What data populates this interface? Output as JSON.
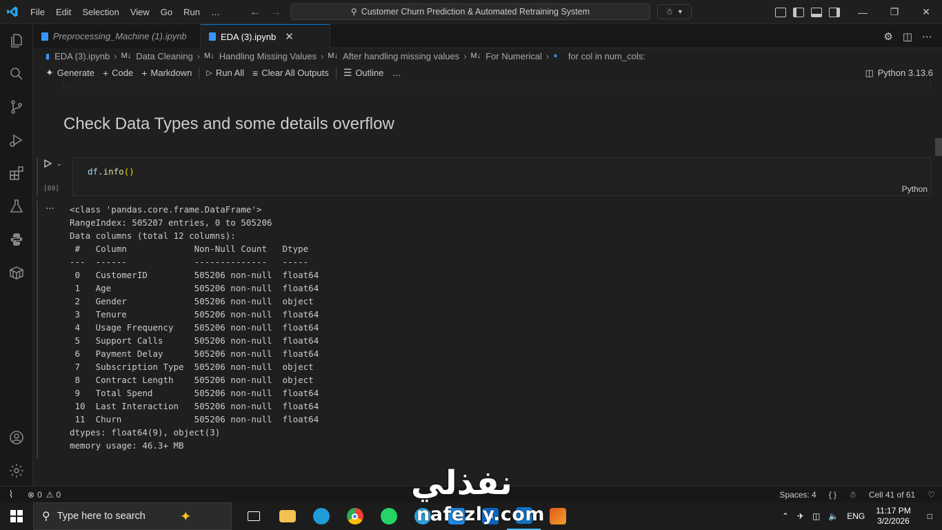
{
  "window": {
    "command_center_text": "Customer Churn Prediction & Automated Retraining System",
    "menu": [
      "File",
      "Edit",
      "Selection",
      "View",
      "Go",
      "Run",
      "…"
    ]
  },
  "tabs": [
    {
      "label": "Preprocessing_Machine (1).ipynb",
      "active": false
    },
    {
      "label": "EDA (3).ipynb",
      "active": true
    }
  ],
  "breadcrumbs": [
    {
      "icon": "notebook-icon",
      "label": "EDA (3).ipynb"
    },
    {
      "icon": "markdown-icon",
      "label": "Data Cleaning"
    },
    {
      "icon": "markdown-icon",
      "label": "Handling Missing Values"
    },
    {
      "icon": "markdown-icon",
      "label": "After handling missing values"
    },
    {
      "icon": "markdown-icon",
      "label": "For Numerical"
    },
    {
      "icon": "python-icon",
      "label": "for col in num_cols:"
    }
  ],
  "toolbar": {
    "generate": "Generate",
    "code": "Code",
    "markdown": "Markdown",
    "run_all": "Run All",
    "clear_outputs": "Clear All Outputs",
    "outline": "Outline",
    "more": "…",
    "kernel": "Python 3.13.6"
  },
  "notebook": {
    "heading": "Check Data Types and some details overflow",
    "cell": {
      "code_obj": "df",
      "code_dot": ".",
      "code_fn": "info",
      "code_paren": "()",
      "execution_count": "[69]",
      "language": "Python"
    },
    "output_lines": [
      "<class 'pandas.core.frame.DataFrame'>",
      "RangeIndex: 505207 entries, 0 to 505206",
      "Data columns (total 12 columns):",
      " #   Column             Non-Null Count   Dtype  ",
      "---  ------             --------------   -----  ",
      " 0   CustomerID         505206 non-null  float64",
      " 1   Age                505206 non-null  float64",
      " 2   Gender             505206 non-null  object ",
      " 3   Tenure             505206 non-null  float64",
      " 4   Usage Frequency    505206 non-null  float64",
      " 5   Support Calls      505206 non-null  float64",
      " 6   Payment Delay      505206 non-null  float64",
      " 7   Subscription Type  505206 non-null  object ",
      " 8   Contract Length    505206 non-null  object ",
      " 9   Total Spend        505206 non-null  float64",
      " 10  Last Interaction   505206 non-null  float64",
      " 11  Churn              505206 non-null  float64",
      "dtypes: float64(9), object(3)",
      "memory usage: 46.3+ MB"
    ]
  },
  "statusbar": {
    "errors": "0",
    "warnings": "0",
    "spaces": "Spaces: 4",
    "braces": "{ }",
    "cell_position": "Cell 41 of 61"
  },
  "taskbar": {
    "search_placeholder": "Type here to search",
    "language": "ENG",
    "time": "11:17 PM",
    "date": "3/2/2026"
  },
  "watermark": {
    "arabic": "نفذلي",
    "latin": "nafezly.com"
  }
}
